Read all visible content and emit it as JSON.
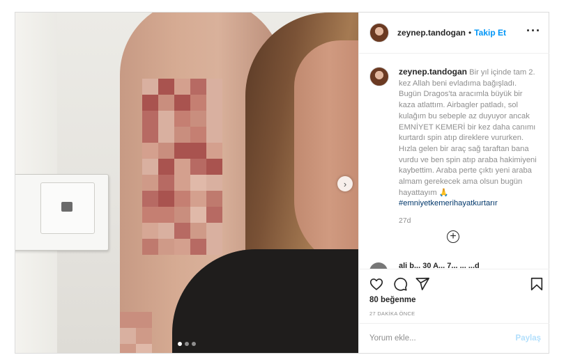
{
  "post": {
    "username": "zeynep.tandogan",
    "separator": "•",
    "follow_label": "Takip Et",
    "more_icon": "more-options-icon",
    "caption_body": "Bir yıl içinde tam 2. kez Allah beni evladıma bağışladı. Bugün Dragos'ta aracımla büyük bir kaza atlattım. Airbagler patladı, sol kulağım bu sebeple az duyuyor ancak EMNİYET KEMERİ bir kez daha canımı kurtardı spin atıp direklere vururken. Hızla gelen bir araç sağ taraftan bana vurdu ve ben spin atıp araba hakimiyeni kaybettim. Araba perte çıktı yeni araba almam gerekecek ama olsun bugün hayattayım 🙏",
    "hashtag": "#emniyetkemerihayatkurtarır",
    "time_ago": "27d",
    "cut_comment_text": "ali b... 30 A... 7... ... ...d",
    "likes": "80 beğenme",
    "posted_time": "27 DAKİKA ÖNCE",
    "comment_placeholder": "Yorum ekle...",
    "share_label": "Paylaş",
    "carousel": {
      "slide_count": 3,
      "active_index": 0
    }
  },
  "icons": {
    "like": "heart-icon",
    "comment": "comment-icon",
    "share": "send-icon",
    "save": "bookmark-icon",
    "next": "chevron-right-icon",
    "load_more": "plus-circle-icon"
  },
  "colors": {
    "follow": "#0095f6",
    "link": "#00376b",
    "secondary_text": "#8e8e8e",
    "disabled_share": "#b2dffc",
    "border": "#dbdbdb"
  }
}
